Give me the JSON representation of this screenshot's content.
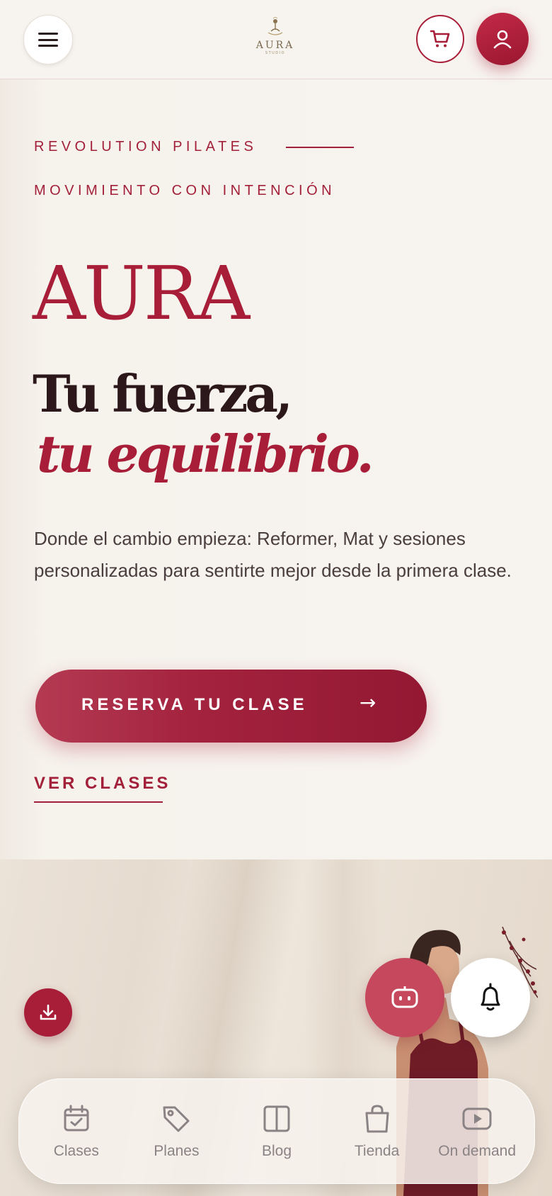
{
  "colors": {
    "accent": "#a81e38",
    "dark": "#2c171b",
    "background": "#f7f3ee"
  },
  "header": {
    "menu_icon": "hamburger-menu-icon",
    "logo": {
      "word": "AURA",
      "sub": "STUDIO"
    },
    "cart_icon": "cart-icon",
    "user_icon": "user-icon"
  },
  "hero": {
    "eyebrow1": "REVOLUTION PILATES",
    "eyebrow2": "MOVIMIENTO CON INTENCIÓN",
    "brand": "AURA",
    "headline_line1": "Tu fuerza,",
    "headline_line2": "tu equilibrio.",
    "description": "Donde el cambio empieza: Reformer, Mat y sesiones personalizadas para sentirte mejor desde la primera clase.",
    "cta_label": "RESERVA TU CLASE",
    "cta_arrow": "→",
    "secondary_link": "VER CLASES"
  },
  "floating": {
    "download_icon": "download-icon",
    "bot_icon": "robot-icon",
    "bell_icon": "bell-icon"
  },
  "bottom_nav": [
    {
      "label": "Clases",
      "icon": "calendar-check-icon"
    },
    {
      "label": "Planes",
      "icon": "tag-icon"
    },
    {
      "label": "Blog",
      "icon": "book-columns-icon"
    },
    {
      "label": "Tienda",
      "icon": "shopping-bag-icon"
    },
    {
      "label": "On demand",
      "icon": "play-video-icon"
    }
  ]
}
